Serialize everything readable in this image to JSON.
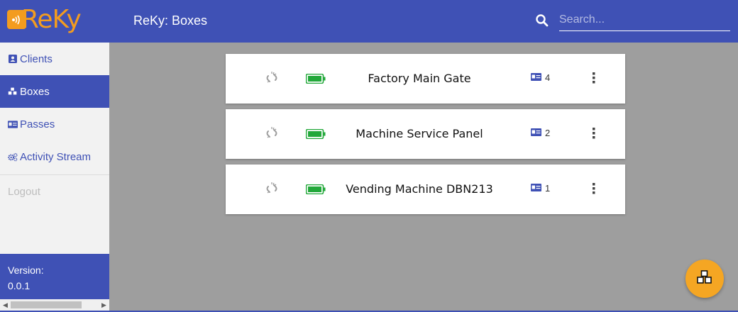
{
  "app": {
    "logo_text": "ReKy",
    "title": "ReKy: Boxes"
  },
  "search": {
    "placeholder": "Search...",
    "value": ""
  },
  "sidebar": {
    "items": [
      {
        "label": "Clients",
        "icon": "user-card-icon"
      },
      {
        "label": "Boxes",
        "icon": "cubes-icon"
      },
      {
        "label": "Passes",
        "icon": "id-card-icon"
      },
      {
        "label": "Activity Stream",
        "icon": "gears-icon"
      }
    ],
    "logout_label": "Logout",
    "version_label": "Version:",
    "version_value": "0.0.1"
  },
  "boxes": [
    {
      "name": "Factory Main Gate",
      "pass_count": "4"
    },
    {
      "name": "Machine Service Panel",
      "pass_count": "2"
    },
    {
      "name": "Vending Machine DBN213",
      "pass_count": "1"
    }
  ],
  "colors": {
    "primary": "#3f51b5",
    "accent": "#f39c1f",
    "battery": "#22a83a",
    "background": "#9e9e9e"
  }
}
